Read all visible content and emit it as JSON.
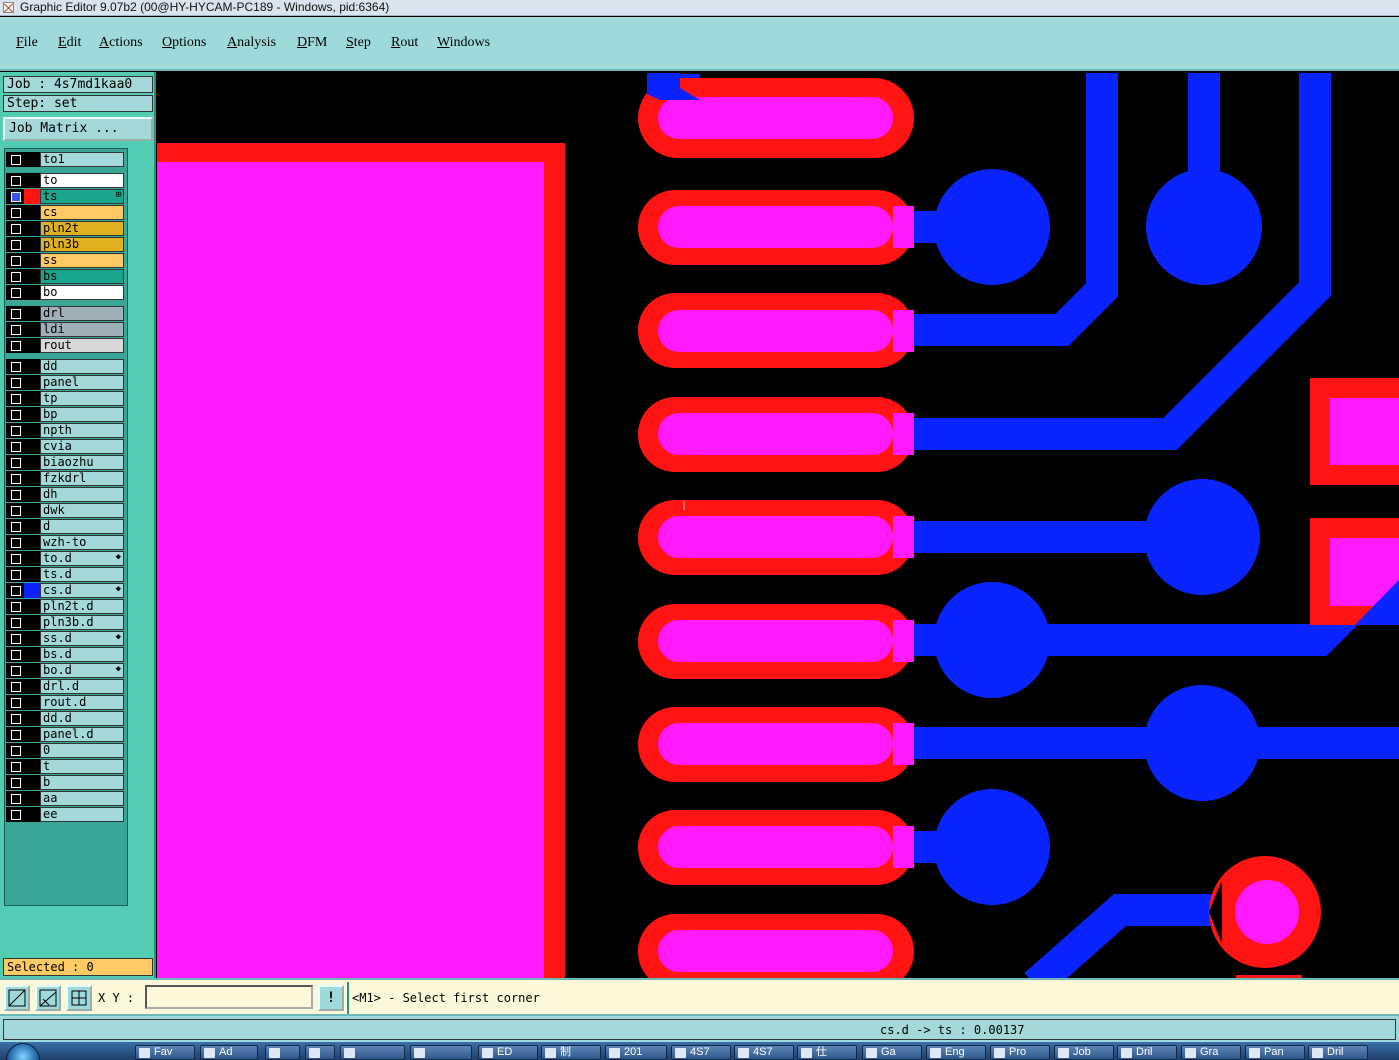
{
  "window": {
    "title": "Graphic Editor 9.07b2 (00@HY-HYCAM-PC189 - Windows, pid:6364)"
  },
  "menu": [
    "File",
    "Edit",
    "Actions",
    "Options",
    "Analysis",
    "DFM",
    "Step",
    "Rout",
    "Windows"
  ],
  "job": {
    "label": "Job : 4s7md1kaa0",
    "step": "Step: set",
    "matrix_button": "Job Matrix ..."
  },
  "colors": {
    "pad_outer": "#ff1414",
    "pad_inner": "#ff1aff",
    "trace": "#0a24ff",
    "background": "#000000",
    "panel": "#52cdb3"
  },
  "layers": [
    {
      "name": "to1",
      "bg": "#a5d8d8",
      "swatch": "#000000",
      "checked": false,
      "flag": ""
    },
    {
      "name": "to",
      "bg": "#ffffff",
      "swatch": "#000000",
      "checked": false,
      "flag": ""
    },
    {
      "name": "ts",
      "bg": "#1ba58c",
      "swatch": "#ff1414",
      "checked": true,
      "flag": "⊞"
    },
    {
      "name": "cs",
      "bg": "#ffca63",
      "swatch": "#000000",
      "checked": false,
      "flag": ""
    },
    {
      "name": "pln2t",
      "bg": "#e0b020",
      "swatch": "#000000",
      "checked": false,
      "flag": ""
    },
    {
      "name": "pln3b",
      "bg": "#e0b020",
      "swatch": "#000000",
      "checked": false,
      "flag": ""
    },
    {
      "name": "ss",
      "bg": "#ffca63",
      "swatch": "#000000",
      "checked": false,
      "flag": ""
    },
    {
      "name": "bs",
      "bg": "#1ba58c",
      "swatch": "#000000",
      "checked": false,
      "flag": ""
    },
    {
      "name": "bo",
      "bg": "#ffffff",
      "swatch": "#000000",
      "checked": false,
      "flag": ""
    },
    {
      "name": "drl",
      "bg": "#9fb0b8",
      "swatch": "#000000",
      "checked": false,
      "flag": ""
    },
    {
      "name": "ldi",
      "bg": "#9fb0b8",
      "swatch": "#000000",
      "checked": false,
      "flag": ""
    },
    {
      "name": "rout",
      "bg": "#d8d8d8",
      "swatch": "#000000",
      "checked": false,
      "flag": ""
    },
    {
      "name": "dd",
      "bg": "#a5d8d8",
      "swatch": "#000000",
      "checked": false,
      "flag": ""
    },
    {
      "name": "panel",
      "bg": "#a5d8d8",
      "swatch": "#000000",
      "checked": false,
      "flag": ""
    },
    {
      "name": "tp",
      "bg": "#a5d8d8",
      "swatch": "#000000",
      "checked": false,
      "flag": ""
    },
    {
      "name": "bp",
      "bg": "#a5d8d8",
      "swatch": "#000000",
      "checked": false,
      "flag": ""
    },
    {
      "name": "npth",
      "bg": "#a5d8d8",
      "swatch": "#000000",
      "checked": false,
      "flag": ""
    },
    {
      "name": "cvia",
      "bg": "#a5d8d8",
      "swatch": "#000000",
      "checked": false,
      "flag": ""
    },
    {
      "name": "biaozhu",
      "bg": "#a5d8d8",
      "swatch": "#000000",
      "checked": false,
      "flag": ""
    },
    {
      "name": "fzkdrl",
      "bg": "#a5d8d8",
      "swatch": "#000000",
      "checked": false,
      "flag": ""
    },
    {
      "name": "dh",
      "bg": "#a5d8d8",
      "swatch": "#000000",
      "checked": false,
      "flag": ""
    },
    {
      "name": "dwk",
      "bg": "#a5d8d8",
      "swatch": "#000000",
      "checked": false,
      "flag": ""
    },
    {
      "name": "d",
      "bg": "#a5d8d8",
      "swatch": "#000000",
      "checked": false,
      "flag": ""
    },
    {
      "name": "wzh-to",
      "bg": "#a5d8d8",
      "swatch": "#000000",
      "checked": false,
      "flag": ""
    },
    {
      "name": "to.d",
      "bg": "#a5d8d8",
      "swatch": "#000000",
      "checked": false,
      "flag": "◆"
    },
    {
      "name": "ts.d",
      "bg": "#a5d8d8",
      "swatch": "#000000",
      "checked": false,
      "flag": ""
    },
    {
      "name": "cs.d",
      "bg": "#a5d8d8",
      "swatch": "#0a24ff",
      "checked": false,
      "flag": "◆"
    },
    {
      "name": "pln2t.d",
      "bg": "#a5d8d8",
      "swatch": "#000000",
      "checked": false,
      "flag": ""
    },
    {
      "name": "pln3b.d",
      "bg": "#a5d8d8",
      "swatch": "#000000",
      "checked": false,
      "flag": ""
    },
    {
      "name": "ss.d",
      "bg": "#a5d8d8",
      "swatch": "#000000",
      "checked": false,
      "flag": "◆"
    },
    {
      "name": "bs.d",
      "bg": "#a5d8d8",
      "swatch": "#000000",
      "checked": false,
      "flag": ""
    },
    {
      "name": "bo.d",
      "bg": "#a5d8d8",
      "swatch": "#000000",
      "checked": false,
      "flag": "◆"
    },
    {
      "name": "drl.d",
      "bg": "#a5d8d8",
      "swatch": "#000000",
      "checked": false,
      "flag": ""
    },
    {
      "name": "rout.d",
      "bg": "#a5d8d8",
      "swatch": "#000000",
      "checked": false,
      "flag": ""
    },
    {
      "name": "dd.d",
      "bg": "#a5d8d8",
      "swatch": "#000000",
      "checked": false,
      "flag": ""
    },
    {
      "name": "panel.d",
      "bg": "#a5d8d8",
      "swatch": "#000000",
      "checked": false,
      "flag": ""
    },
    {
      "name": "0",
      "bg": "#a5d8d8",
      "swatch": "#000000",
      "checked": false,
      "flag": ""
    },
    {
      "name": "t",
      "bg": "#a5d8d8",
      "swatch": "#000000",
      "checked": false,
      "flag": ""
    },
    {
      "name": "b",
      "bg": "#a5d8d8",
      "swatch": "#000000",
      "checked": false,
      "flag": ""
    },
    {
      "name": "aa",
      "bg": "#a5d8d8",
      "swatch": "#000000",
      "checked": false,
      "flag": ""
    },
    {
      "name": "ee",
      "bg": "#a5d8d8",
      "swatch": "#000000",
      "checked": false,
      "flag": ""
    }
  ],
  "selected": "Selected : 0",
  "command": {
    "xy_label": "X Y :",
    "xy_value": "",
    "bang": "!",
    "prompt": "<M1> - Select first corner"
  },
  "status": "cs.d -> ts : 0.00137",
  "taskbar": [
    "Fav",
    "Ad",
    "",
    "",
    "",
    "",
    "ED",
    "制",
    "201",
    "4S7",
    "4S7",
    "仕",
    "Ga",
    "Eng",
    "Pro",
    "Job",
    "Dril",
    "Gra",
    "Pan",
    "Dril"
  ]
}
